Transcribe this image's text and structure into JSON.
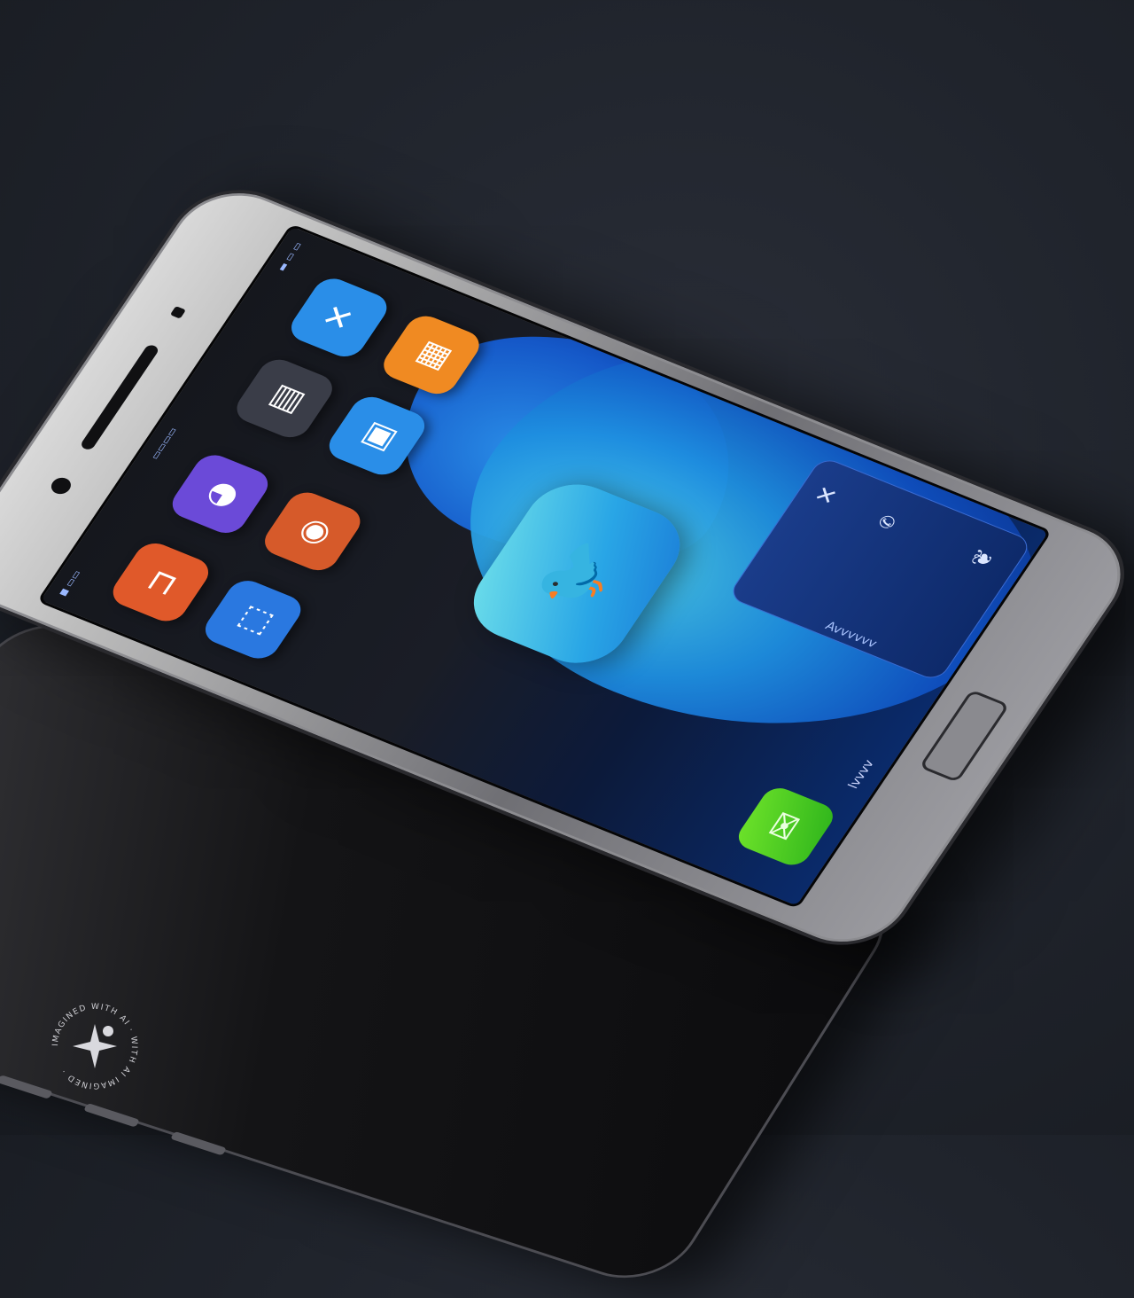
{
  "scene": {
    "description_colors": {
      "background": "#1f232b",
      "screen_accent": "#1e8fe0",
      "center_app": "#29a6e6"
    }
  },
  "phone": {
    "status": {
      "left_text": "◼ ▭▭",
      "carrier_text": "▭▭▭▭",
      "right_text": "▬ ▭ ▭"
    },
    "apps": [
      {
        "icon": "orange-square-icon",
        "glyph": "⊐",
        "color": "#e0592a"
      },
      {
        "icon": "purple-chat-icon",
        "glyph": "◕",
        "color": "#6b4ad8"
      },
      {
        "icon": "blue-square-icon",
        "glyph": "⬚",
        "color": "#2a78e0"
      },
      {
        "icon": "dark-gallery-icon",
        "glyph": "▤",
        "color": "#3a3d48"
      },
      {
        "icon": "orange-camera-icon",
        "glyph": "◉",
        "color": "#d65a2a"
      },
      {
        "icon": "blue-x-icon",
        "glyph": "✕",
        "color": "#2a8ee8"
      },
      {
        "icon": "blue-photo-icon",
        "glyph": "▣",
        "color": "#2a8ee8"
      },
      {
        "icon": "orange-multi-icon",
        "glyph": "▦",
        "color": "#f08a22"
      }
    ],
    "center_app": {
      "icon": "bird-icon",
      "glyph": "🐦"
    },
    "dock": {
      "label": "Avvvvvv",
      "top_icon": "cross-icon",
      "top_glyph": "✕",
      "mid_icon": "phone-icon",
      "mid_glyph": "✆",
      "bottom_icon": "leaf-icon",
      "bottom_glyph": "❦"
    },
    "green_app": {
      "icon": "chat-icon",
      "glyph": "✉"
    },
    "bottom_text": "lvvvv"
  },
  "watermark": {
    "text": "IMAGINED WITH AI · WITH AI IMAGINED ·"
  }
}
